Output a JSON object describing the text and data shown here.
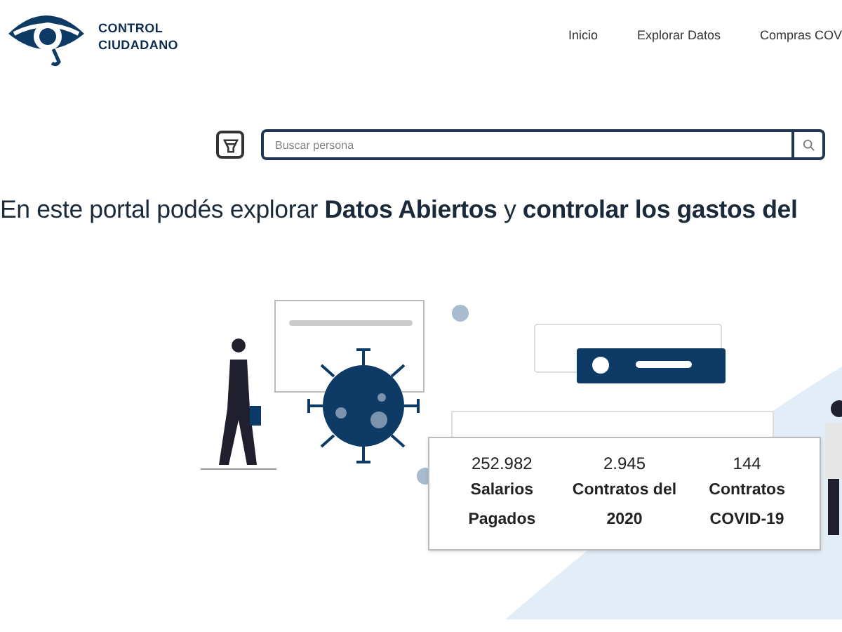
{
  "logo": {
    "line_1": "CONTROL",
    "line_2": "CIUDADANO"
  },
  "nav": [
    {
      "label": "Inicio"
    },
    {
      "label": "Explorar Datos"
    },
    {
      "label": "Compras COV"
    }
  ],
  "search": {
    "placeholder": "Buscar persona"
  },
  "headline": "En este portal podés explorar **Datos Abiertos** y **controlar los gastos del**",
  "stats": [
    {
      "value": "252.982",
      "label": "Salarios Pagados"
    },
    {
      "value": "2.945",
      "label": "Contratos del 2020"
    },
    {
      "value": "144",
      "label": "Contratos COVID-19"
    }
  ]
}
